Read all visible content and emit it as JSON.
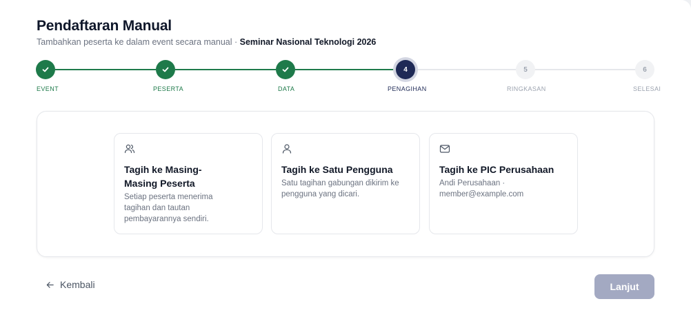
{
  "header": {
    "title": "Pendaftaran Manual",
    "subtitle": "Tambahkan peserta ke dalam event secara manual ·",
    "event_name": "Seminar Nasional Teknologi 2026"
  },
  "steps": [
    {
      "number": "1",
      "label": "EVENT",
      "status": "done"
    },
    {
      "number": "2",
      "label": "PESERTA",
      "status": "done"
    },
    {
      "number": "3",
      "label": "DATA",
      "status": "done"
    },
    {
      "number": "4",
      "label": "PENAGIHAN",
      "status": "active"
    },
    {
      "number": "5",
      "label": "RINGKASAN",
      "status": "todo"
    },
    {
      "number": "6",
      "label": "SELESAI",
      "status": "todo"
    }
  ],
  "options": [
    {
      "icon": "users-icon",
      "title_line1": "Tagih ke Masing-",
      "title_line2": "Masing Peserta",
      "description": "Setiap peserta menerima tagihan dan tautan pembayarannya sendiri."
    },
    {
      "icon": "user-icon",
      "title_line1": "Tagih ke Satu Pengguna",
      "description": "Satu tagihan gabungan dikirim ke pengguna yang dicari."
    },
    {
      "icon": "mail-icon",
      "title_line1": "Tagih ke PIC Perusahaan",
      "description_line1": "Andi Perusahaan ·",
      "description_line2": "member@example.com"
    }
  ],
  "footer": {
    "back_label": "Kembali",
    "next_label": "Lanjut"
  },
  "colors": {
    "done": "#1e7a4a",
    "active": "#1f2a56",
    "next_disabled": "#a3a9c2"
  }
}
